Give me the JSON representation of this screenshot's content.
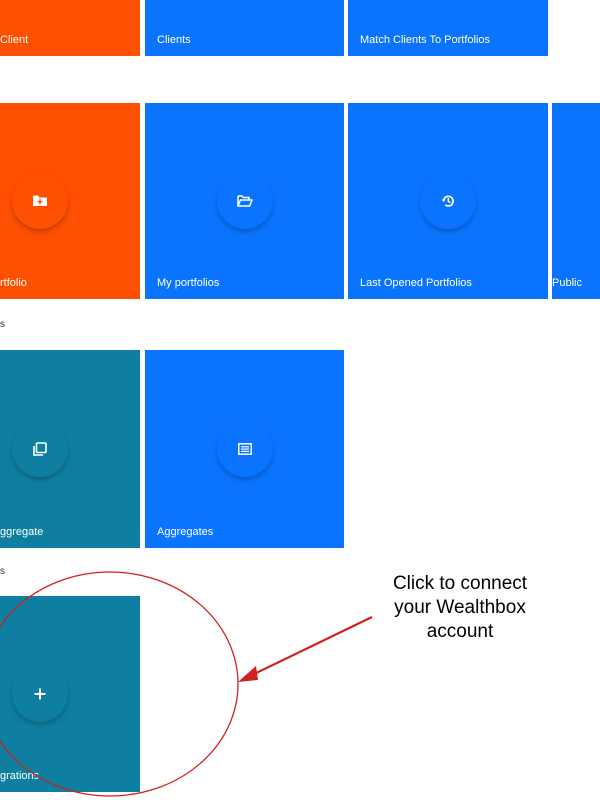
{
  "colors": {
    "orange": "#FF4F00",
    "blue": "#0A74FF",
    "teal": "#0E7FA1",
    "annotation_red": "#D21F1F"
  },
  "clients_row": {
    "tiles": [
      {
        "label": "Client",
        "color": "orange"
      },
      {
        "label": "Clients",
        "color": "blue"
      },
      {
        "label": "Match Clients To Portfolios",
        "color": "blue"
      }
    ]
  },
  "portfolios_row": {
    "tiles": [
      {
        "label": "rtfolio",
        "icon": "folder-plus-icon",
        "color": "orange"
      },
      {
        "label": "My portfolios",
        "icon": "folder-open-icon",
        "color": "blue"
      },
      {
        "label": "Last Opened Portfolios",
        "icon": "history-icon",
        "color": "blue"
      },
      {
        "label": "Public",
        "color": "blue"
      }
    ]
  },
  "aggregates_section": {
    "label": "s",
    "tiles": [
      {
        "label": "ggregate",
        "icon": "copy-icon",
        "color": "teal"
      },
      {
        "label": "Aggregates",
        "icon": "list-icon",
        "color": "blue"
      }
    ]
  },
  "integrations_section": {
    "label": "s",
    "tiles": [
      {
        "label": "grations",
        "icon": "plus-icon",
        "color": "teal"
      }
    ]
  },
  "annotation": {
    "text_line1": "Click to connect",
    "text_line2": "your Wealthbox",
    "text_line3": "account"
  }
}
